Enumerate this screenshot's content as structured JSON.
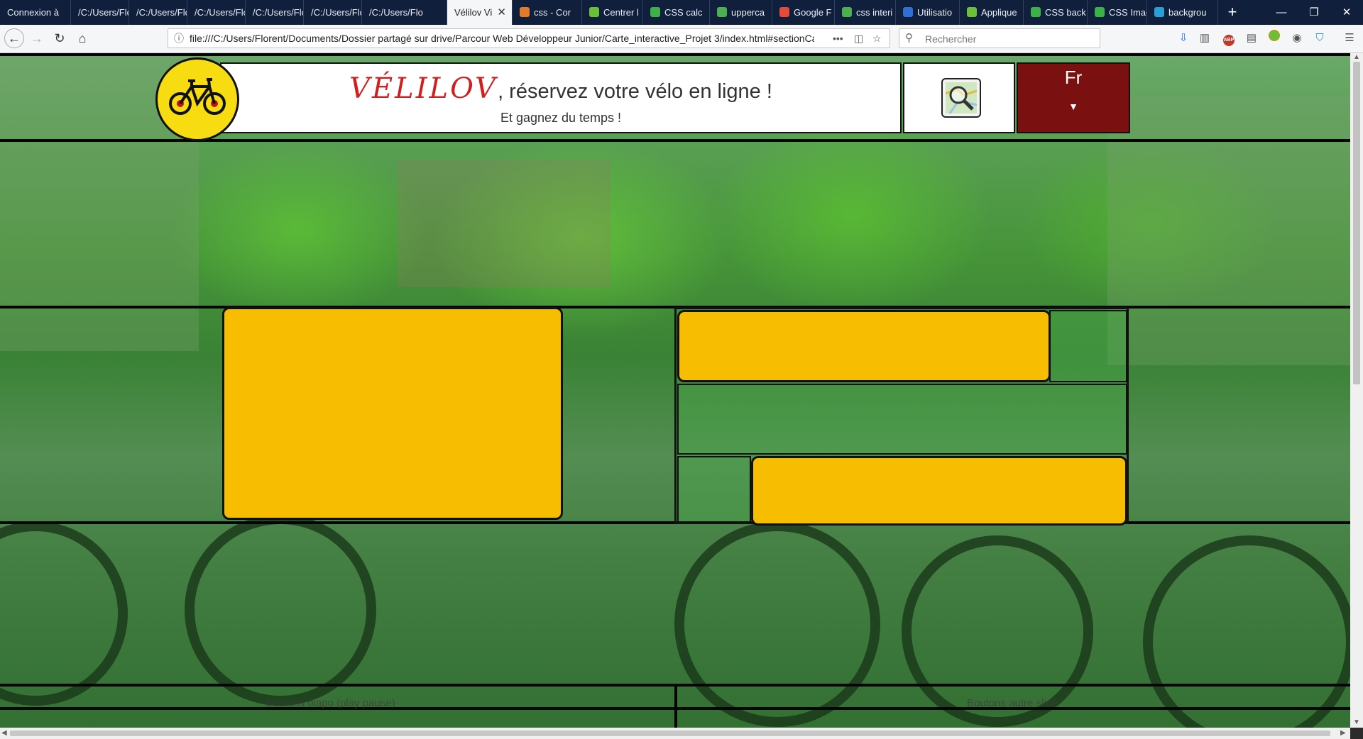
{
  "browser": {
    "tabs": [
      {
        "label": "Connexion à",
        "active": false
      },
      {
        "label": "/C:/Users/Flo",
        "active": false
      },
      {
        "label": "/C:/Users/Flo",
        "active": false
      },
      {
        "label": "/C:/Users/Flo",
        "active": false
      },
      {
        "label": "/C:/Users/Flo",
        "active": false
      },
      {
        "label": "/C:/Users/Flo",
        "active": false
      },
      {
        "label": "/C:/Users/Flo",
        "active": false
      },
      {
        "label": "Vélilov Vi",
        "active": true
      },
      {
        "label": "css - Cor",
        "active": false
      },
      {
        "label": "Centrer l",
        "active": false
      },
      {
        "label": "CSS calc",
        "active": false
      },
      {
        "label": "upperca",
        "active": false
      },
      {
        "label": "Google F",
        "active": false
      },
      {
        "label": "css interi",
        "active": false
      },
      {
        "label": "Utilisatio",
        "active": false
      },
      {
        "label": "Applique",
        "active": false
      },
      {
        "label": "CSS back",
        "active": false
      },
      {
        "label": "CSS Imag",
        "active": false
      },
      {
        "label": "backgrou",
        "active": false
      }
    ],
    "url": "file:///C:/Users/Florent/Documents/Dossier partagé sur drive/Parcour Web Développeur Junior/Carte_interactive_Projet 3/index.html#sectionCa",
    "search_placeholder": "Rechercher",
    "new_tab": "+",
    "tab_close": "✕",
    "win_min": "—",
    "win_max": "❐",
    "win_close": "✕"
  },
  "header": {
    "brand": "VÉLILOV",
    "tagline": ", réservez votre vélo en ligne !",
    "subtitle": "Et gagnez du temps !",
    "language": "Fr",
    "caret": "▼"
  },
  "footer": {
    "left_label": "Boutons diapo (play pause)",
    "right_label": "Boutons autre slide"
  },
  "colors": {
    "logo_yellow": "#f8dc12",
    "brand_red": "#d01f1f",
    "language_bg": "#7a1010",
    "panel_yellow": "#f7bd00"
  }
}
